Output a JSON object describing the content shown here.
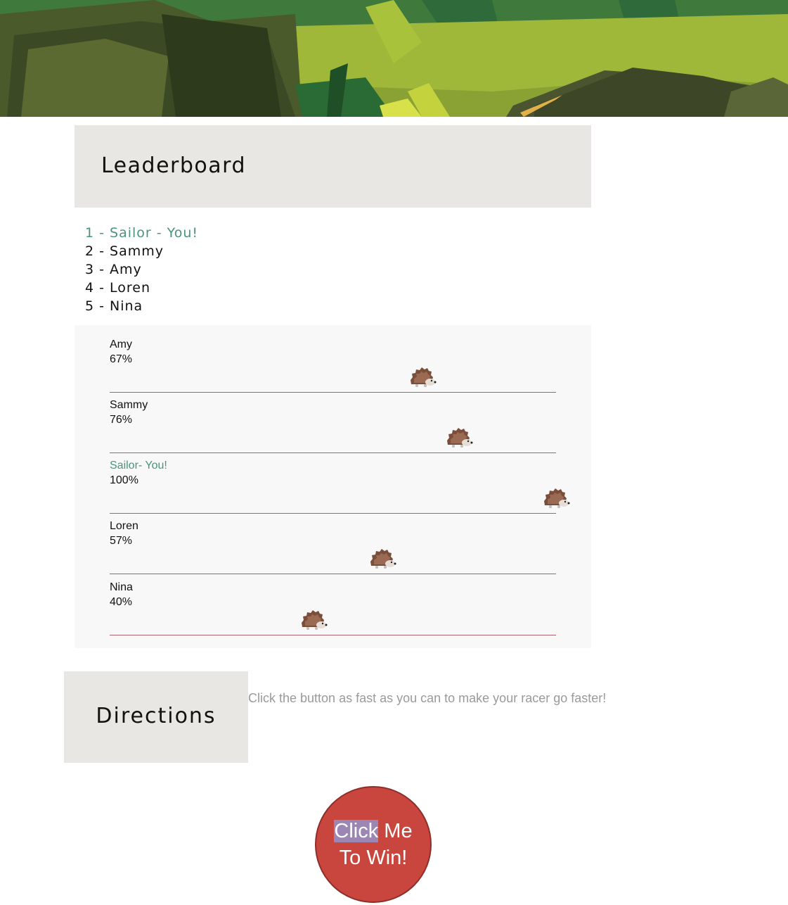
{
  "leaderboard": {
    "title": "Leaderboard",
    "ranking": [
      {
        "text": "1 - Sailor - You!",
        "you": true
      },
      {
        "text": "2 - Sammy",
        "you": false
      },
      {
        "text": "3 - Amy",
        "you": false
      },
      {
        "text": "4 - Loren",
        "you": false
      },
      {
        "text": "5 - Nina",
        "you": false
      }
    ]
  },
  "race": {
    "lanes": [
      {
        "name": "Amy",
        "percent_label": "67%",
        "progress": 0.67,
        "you": false
      },
      {
        "name": "Sammy",
        "percent_label": "76%",
        "progress": 0.76,
        "you": false
      },
      {
        "name": "Sailor- You!",
        "percent_label": "100%",
        "progress": 1.0,
        "you": true
      },
      {
        "name": "Loren",
        "percent_label": "57%",
        "progress": 0.57,
        "you": false
      },
      {
        "name": "Nina",
        "percent_label": "40%",
        "progress": 0.4,
        "you": false
      }
    ],
    "racer_icon": "hedgehog-icon"
  },
  "directions": {
    "title": "Directions",
    "text": "Click the button as fast as you can to make your racer go faster!"
  },
  "button": {
    "word1": "Click",
    "word2": "Me",
    "line2": "To Win!"
  },
  "colors": {
    "you_highlight": "#4a9479",
    "button_red": "#c8463d",
    "track_line": "#a8606a",
    "panel_gray": "#e8e7e3"
  }
}
